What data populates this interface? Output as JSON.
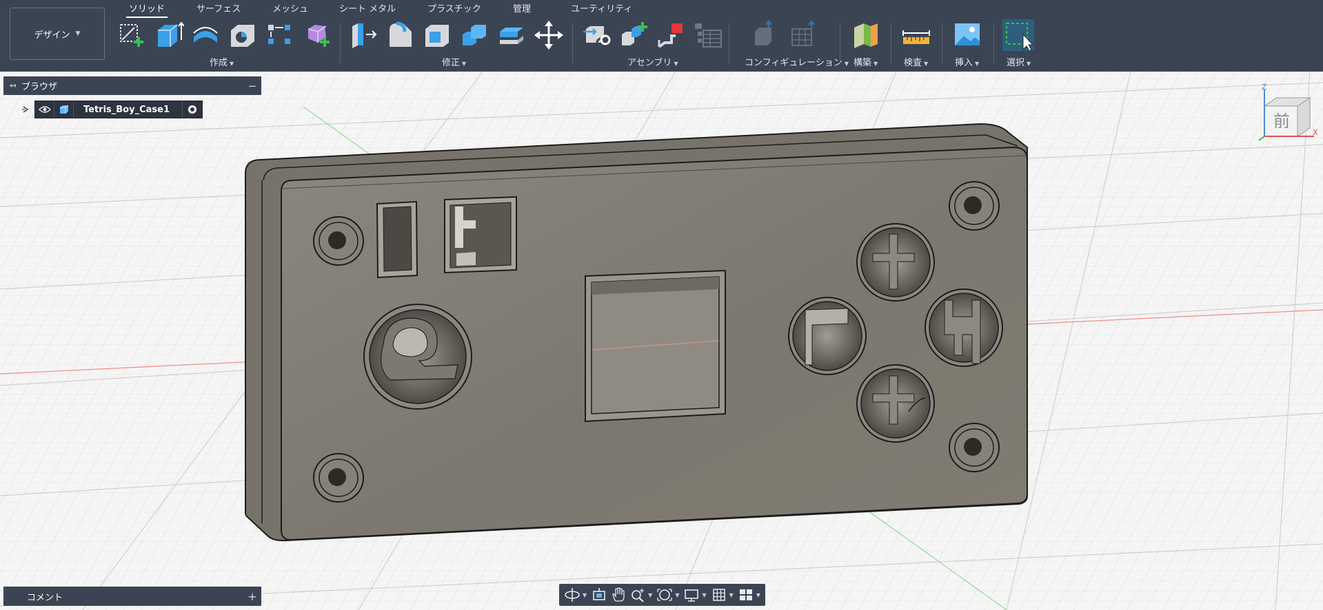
{
  "workspace": {
    "label": "デザイン"
  },
  "tabs": [
    {
      "label": "ソリッド",
      "active": true
    },
    {
      "label": "サーフェス",
      "active": false
    },
    {
      "label": "メッシュ",
      "active": false
    },
    {
      "label": "シート メタル",
      "active": false
    },
    {
      "label": "プラスチック",
      "active": false
    },
    {
      "label": "管理",
      "active": false
    },
    {
      "label": "ユーティリティ",
      "active": false
    }
  ],
  "groups": {
    "create": "作成",
    "modify": "修正",
    "assemble": "アセンブリ",
    "configure": "コンフィギュレーション",
    "construct": "構築",
    "inspect": "検査",
    "insert": "挿入",
    "select": "選択"
  },
  "browser": {
    "title": "ブラウザ",
    "document_name": "Tetris_Boy_Case1"
  },
  "comments": {
    "title": "コメント"
  },
  "viewcube": {
    "face_label": "前",
    "axis_z": "Z",
    "axis_x": "X"
  },
  "icons": {
    "tools": [
      "create-sketch-icon",
      "extrude-icon",
      "revolve-icon",
      "hole-icon",
      "pattern-icon",
      "create-form-icon",
      "press-pull-icon",
      "fillet-icon",
      "shell-icon",
      "combine-icon",
      "offset-face-icon",
      "move-icon",
      "new-component-icon",
      "joint-icon",
      "as-built-joint-icon",
      "table-icon",
      "config-icon-1",
      "config-icon-2",
      "plane-icon",
      "measure-icon",
      "insert-image-icon",
      "select-icon"
    ],
    "navbar": [
      "orbit-icon",
      "look-at-icon",
      "pan-icon",
      "zoom-icon",
      "fit-icon",
      "display-icon",
      "grid-icon",
      "viewports-icon"
    ]
  },
  "colors": {
    "toolbar": "#3b4453",
    "model_face": "#7f7b72",
    "grid": "#d6d6d6",
    "accent_blue": "#3aa0e8"
  }
}
